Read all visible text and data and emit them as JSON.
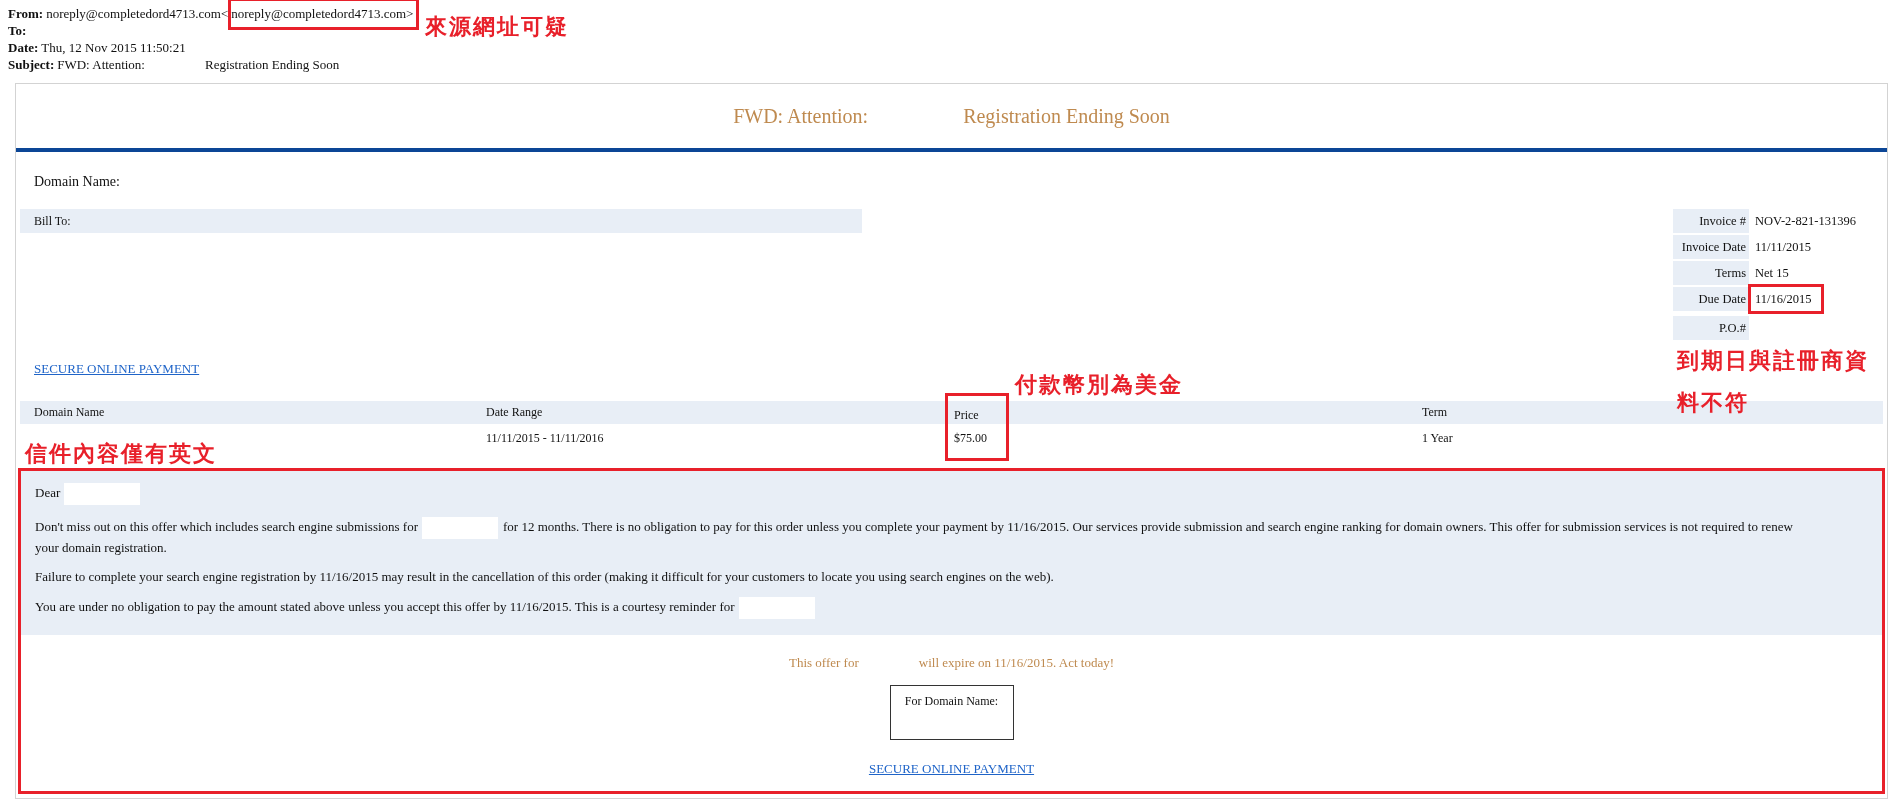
{
  "header": [
    {
      "label": "From:",
      "value_parts": [
        {
          "text": "noreply@completedord4713.com<",
          "flagged": false
        },
        {
          "text": "noreply@completedord4713.com>",
          "flagged": true
        }
      ]
    },
    {
      "label": "To:"
    },
    {
      "label": "Date:",
      "value_parts": [
        {
          "text": "Thu, 12 Nov 2015 11:50:21",
          "flagged": false
        }
      ]
    },
    {
      "label": "Subject:",
      "value_parts": [
        {
          "text": "FWD: Attention:",
          "flagged": false
        },
        {
          "text": "Registration Ending Soon",
          "flagged": false
        }
      ]
    }
  ],
  "email": {
    "title_parts": [
      "FWD: Attention:",
      "Registration Ending Soon"
    ],
    "domain_label": "Domain Name:",
    "bill_to": "Bill To:",
    "invoice": [
      {
        "label": "Invoice #",
        "value": "NOV-2-821-131396",
        "flagged": false
      },
      {
        "label": "Invoice Date",
        "value": "11/11/2015",
        "flagged": false
      },
      {
        "label": "Terms",
        "value": "Net 15",
        "flagged": false
      },
      {
        "label": "Due Date",
        "value": "11/16/2015",
        "flagged": true
      },
      {
        "label": "P.O.#",
        "flagged": false
      }
    ],
    "payment_link": "SECURE ONLINE PAYMENT",
    "table": {
      "columns": [
        {
          "label": "Domain Name",
          "flagged": false
        },
        {
          "label": "Date Range",
          "flagged": false
        },
        {
          "label": "Price",
          "flagged": true
        },
        {
          "label": "Term",
          "flagged": false
        }
      ],
      "rows": [
        [
          "",
          "11/11/2015 - 11/11/2016",
          "$75.00",
          "1 Year"
        ]
      ]
    },
    "message_flagged": true,
    "body": [
      [
        {
          "kind": "text",
          "text": "Dear"
        },
        {
          "kind": "redaction"
        }
      ],
      [
        {
          "kind": "text",
          "text": "Don't miss out on this offer which includes search engine submissions for"
        },
        {
          "kind": "redaction"
        },
        {
          "kind": "text",
          "text": "for 12 months. There is no obligation to pay for this order unless you complete your payment by 11/16/2015. Our services provide submission and search engine ranking for domain owners. This offer for submission services is not required to renew"
        },
        {
          "kind": "break"
        },
        {
          "kind": "text",
          "text": "your domain registration."
        }
      ],
      [
        {
          "kind": "text",
          "text": "Failure to complete your search engine registration by 11/16/2015 may result in the cancellation of this order (making it difficult for your customers to locate you using search engines on the web)."
        }
      ],
      [
        {
          "kind": "text",
          "text": "You are under no obligation to pay the amount stated above unless you accept this offer by 11/16/2015. This is a courtesy reminder for"
        },
        {
          "kind": "redaction"
        }
      ]
    ],
    "expiry_parts": [
      "This offer for",
      "will expire on 11/16/2015. Act today!"
    ],
    "domain_box": "For Domain Name:",
    "footer_link": "SECURE ONLINE PAYMENT"
  },
  "annotations": [
    "來源網址可疑",
    "付款幣別為美金",
    "到期日與註冊商資料不符",
    "信件內容僅有英文"
  ]
}
